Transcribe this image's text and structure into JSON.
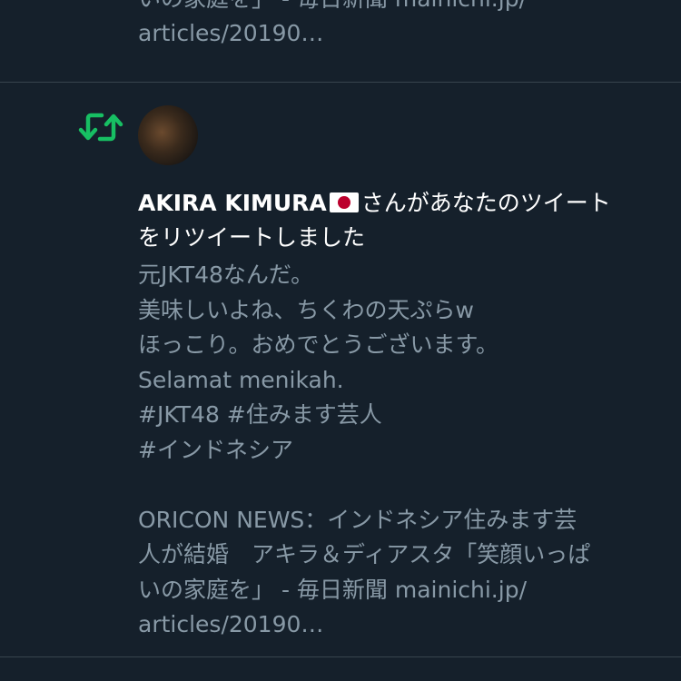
{
  "previous_tweet_tail": {
    "lines": [
      "いの家庭を」 - 毎日新聞 mainichi.jp/",
      "articles/20190…"
    ]
  },
  "notification": {
    "icon": "retweet-icon",
    "icon_color": "#17bf63",
    "user_name": "AKIRA KIMURA",
    "user_flag": "japan-flag-icon",
    "action_text": "さんがあなたのツイート",
    "action_text_2": "をリツイートしました"
  },
  "tweet": {
    "lines": [
      "元JKT48なんだ。",
      "美味しいよね、ちくわの天ぷらw",
      "ほっこり。おめでとうございます。",
      "Selamat menikah.",
      "#JKT48 #住みます芸人",
      "#インドネシア",
      "",
      "ORICON NEWS：インドネシア住みます芸",
      "人が結婚　アキラ＆ディアスタ「笑顔いっぱ",
      "いの家庭を」 - 毎日新聞 mainichi.jp/",
      "articles/20190…"
    ]
  },
  "colors": {
    "background": "#15202b",
    "secondary_text": "#8899a6",
    "divider": "#38444d",
    "retweet_green": "#17bf63"
  }
}
